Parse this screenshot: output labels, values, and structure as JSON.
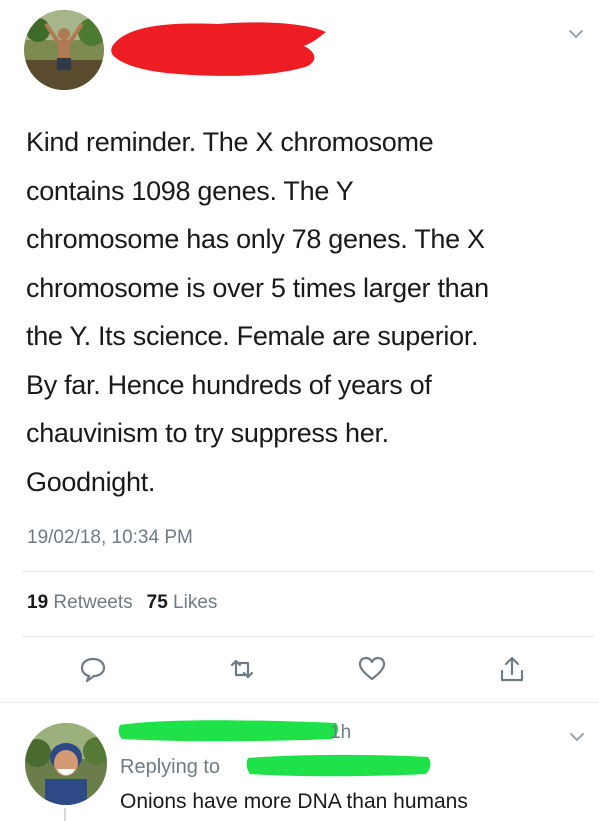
{
  "tweet": {
    "author_name": "",
    "text_lines": [
      "Kind reminder. The X chromosome",
      "contains 1098 genes. The Y",
      "chromosome has only 78 genes. The X",
      "chromosome is over 5 times larger than",
      "the Y. Its science. Female are superior.",
      "By far. Hence hundreds of years of",
      "chauvinism to try suppress her.",
      "Goodnight."
    ],
    "timestamp": "19/02/18, 10:34 PM",
    "retweet_count": "19",
    "retweet_label": "Retweets",
    "like_count": "75",
    "like_label": "Likes",
    "actions": [
      "reply-icon",
      "retweet-icon",
      "heart-icon",
      "share-icon"
    ]
  },
  "reply": {
    "time": "1h",
    "replying_label": "Replying to",
    "text": "Onions have more DNA than humans"
  },
  "colors": {
    "text": "#1a1a1a",
    "secondary": "#6f7b84",
    "divider": "#e3e6e8",
    "redact_red": "#ee1d23",
    "redact_green": "#1fe24a"
  }
}
